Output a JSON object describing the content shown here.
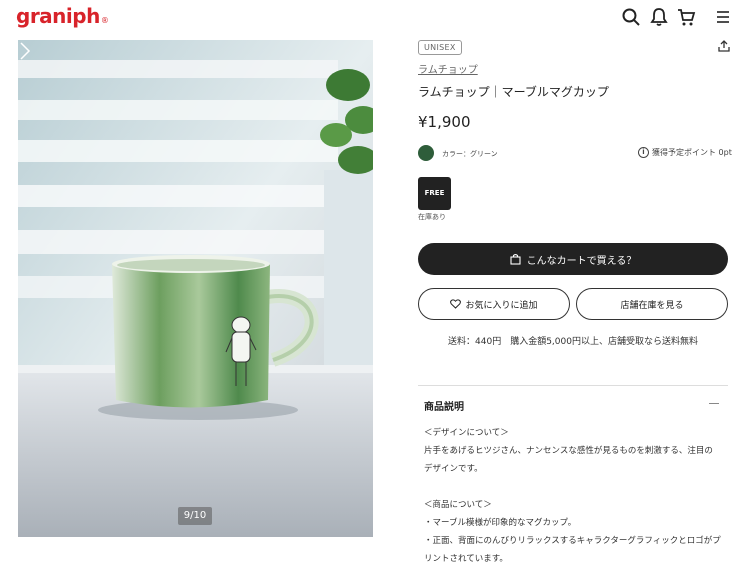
{
  "header": {
    "logo": "graniph",
    "logo_mark": "®",
    "icons": [
      "search-icon",
      "bell-icon",
      "cart-icon",
      "menu-icon"
    ]
  },
  "gallery": {
    "counter": "9/10",
    "colors": {
      "mug_green": "#4f8a4c",
      "mug_light": "#e8efe5",
      "window": "#dfe7ea",
      "sill": "#cfd6db"
    }
  },
  "product": {
    "tag": "UNISEX",
    "brand": "ラムチョップ",
    "name": "ラムチョップ｜マーブルマグカップ",
    "price": "¥1,900",
    "color_label": "カラー：グリーン",
    "color_hex": "#2e5d3a",
    "points_label": "獲得予定ポイント 0pt",
    "size": "FREE",
    "stock": "在庫あり"
  },
  "actions": {
    "cart": "こんなカートで買える？",
    "favorite": "お気に入りに追加",
    "store_stock": "店舗在庫を見る"
  },
  "shipping": "送料：440円　購入金額5,000円以上、店舗受取なら送料無料",
  "description": {
    "title": "商品説明",
    "lines": [
      "＜デザインについて＞",
      "片手をあげるヒツジさん、ナンセンスな感性が見るものを刺激する、注目の",
      "デザインです。",
      "",
      "＜商品について＞",
      "・マーブル模様が印象的なマグカップ。",
      "・正面、背面にのんびりリラックスするキャラクターグラフィックとロゴがプ",
      "リントされています。"
    ]
  }
}
